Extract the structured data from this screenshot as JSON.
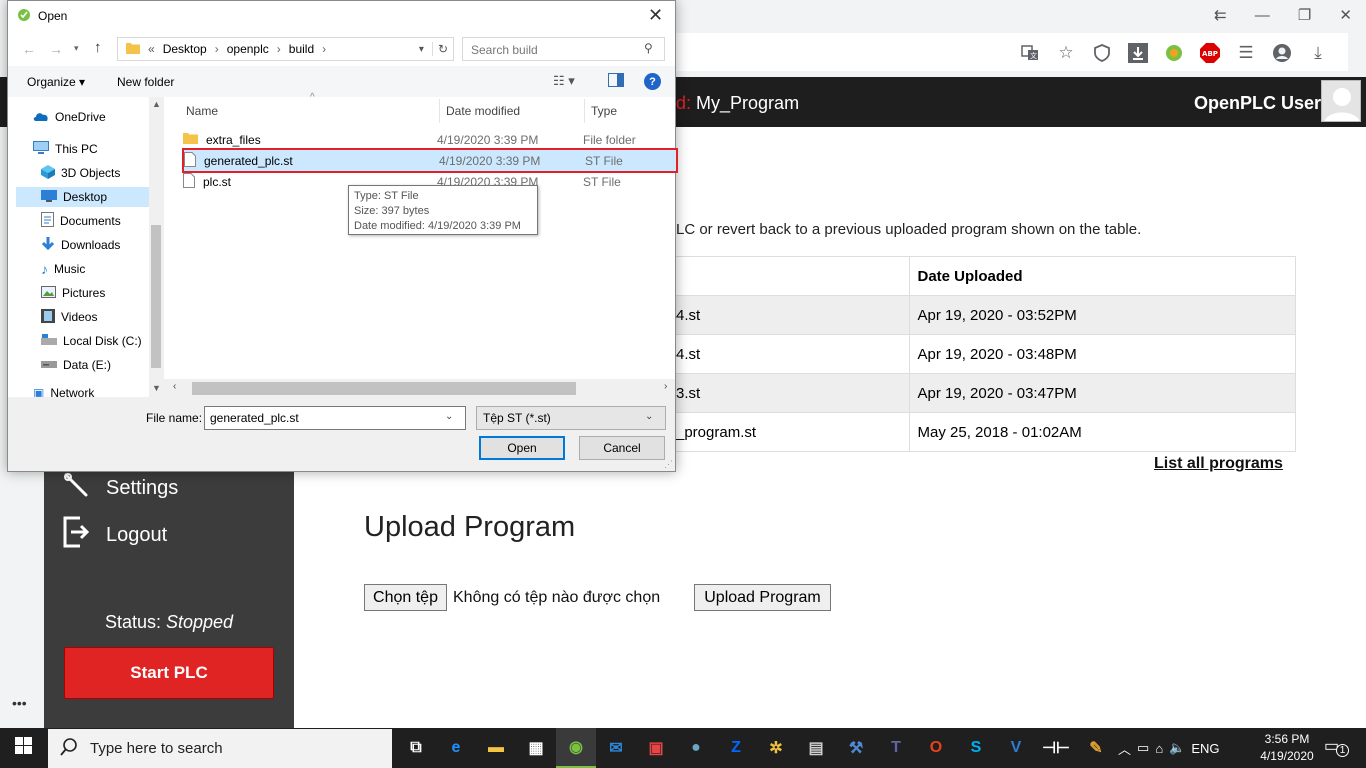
{
  "browser": {
    "window_controls": [
      "⇇",
      "—",
      "❐",
      "✕"
    ],
    "toolbar_icons": [
      "translate-icon",
      "star-icon",
      "shield-icon",
      "download-box-icon",
      "chrome-ext-icon",
      "abp-icon",
      "playlist-icon",
      "account-icon",
      "download-icon"
    ],
    "abp_label": "ABP"
  },
  "plc": {
    "program_prefix": "d:",
    "program_name": "My_Program",
    "user_name": "OpenPLC User",
    "sidebar": {
      "settings_label": "Settings",
      "logout_label": "Logout",
      "status_label": "Status:",
      "status_value": "Stopped",
      "start_button": "Start PLC"
    },
    "intro_text": "LC or revert back to a previous uploaded program shown on the table.",
    "table": {
      "header_date": "Date Uploaded",
      "rows": [
        {
          "file": "4.st",
          "date": "Apr 19, 2020 - 03:52PM"
        },
        {
          "file": "4.st",
          "date": "Apr 19, 2020 - 03:48PM"
        },
        {
          "file": "3.st",
          "date": "Apr 19, 2020 - 03:47PM"
        },
        {
          "file": "_program.st",
          "date": "May 25, 2018 - 01:02AM"
        }
      ]
    },
    "list_all_link": "List all programs",
    "upload_title": "Upload Program",
    "choose_file_button": "Chọn tệp",
    "no_file_text": "Không có tệp nào được chọn",
    "upload_button": "Upload Program",
    "more_dots": "•••"
  },
  "dialog": {
    "title": "Open",
    "path": {
      "prefix": "«",
      "segments": [
        "Desktop",
        "openplc",
        "build"
      ]
    },
    "search_placeholder": "Search build",
    "organize_label": "Organize ▾",
    "new_folder_label": "New folder",
    "help_label": "?",
    "nav_items": [
      {
        "label": "OneDrive",
        "icon": "onedrive-icon"
      },
      {
        "label": "This PC",
        "icon": "pc-icon"
      },
      {
        "label": "3D Objects",
        "icon": "cube-icon"
      },
      {
        "label": "Desktop",
        "icon": "desktop-icon"
      },
      {
        "label": "Documents",
        "icon": "documents-icon"
      },
      {
        "label": "Downloads",
        "icon": "download-icon"
      },
      {
        "label": "Music",
        "icon": "music-icon"
      },
      {
        "label": "Pictures",
        "icon": "pictures-icon"
      },
      {
        "label": "Videos",
        "icon": "videos-icon"
      },
      {
        "label": "Local Disk (C:)",
        "icon": "disk-icon"
      },
      {
        "label": "Data (E:)",
        "icon": "disk-icon"
      },
      {
        "label": "Network",
        "icon": "network-icon"
      }
    ],
    "columns": {
      "name": "Name",
      "date": "Date modified",
      "type": "Type"
    },
    "files": [
      {
        "name": "extra_files",
        "date": "4/19/2020 3:39 PM",
        "type": "File folder",
        "icon": "folder-icon"
      },
      {
        "name": "generated_plc.st",
        "date": "4/19/2020 3:39 PM",
        "type": "ST File",
        "icon": "file-icon"
      },
      {
        "name": "plc.st",
        "date": "4/19/2020 3:39 PM",
        "type": "ST File",
        "icon": "file-icon"
      }
    ],
    "tooltip": {
      "line1": "Type: ST File",
      "line2": "Size: 397 bytes",
      "line3": "Date modified: 4/19/2020 3:39 PM"
    },
    "file_name_label": "File name:",
    "file_name_value": "generated_plc.st",
    "filter_value": "Tệp ST (*.st)",
    "open_button": "Open",
    "cancel_button": "Cancel"
  },
  "taskbar": {
    "search_placeholder": "Type here to search",
    "language": "ENG",
    "time": "3:56 PM",
    "date": "4/19/2020",
    "notification_count": "1",
    "apps": [
      {
        "name": "task-view-icon",
        "glyph": "⧉",
        "color": "#ffffff"
      },
      {
        "name": "edge-icon",
        "glyph": "e",
        "color": "#1e90ff"
      },
      {
        "name": "file-explorer-icon",
        "glyph": "▬",
        "color": "#f4c542"
      },
      {
        "name": "store-icon",
        "glyph": "▦",
        "color": "#ffffff"
      },
      {
        "name": "coccoc-icon",
        "glyph": "◉",
        "color": "#7ac143"
      },
      {
        "name": "mail-icon",
        "glyph": "✉",
        "color": "#2b88d8"
      },
      {
        "name": "app-icon-red",
        "glyph": "▣",
        "color": "#e64545"
      },
      {
        "name": "globe-icon",
        "glyph": "●",
        "color": "#6aa7c4"
      },
      {
        "name": "zalo-icon",
        "glyph": "Z",
        "color": "#0068ff"
      },
      {
        "name": "tool-icon",
        "glyph": "✲",
        "color": "#f0c040"
      },
      {
        "name": "usb-icon",
        "glyph": "▤",
        "color": "#cfcfcf"
      },
      {
        "name": "network-app-icon",
        "glyph": "⚒",
        "color": "#4f8ad8"
      },
      {
        "name": "teams-icon",
        "glyph": "T",
        "color": "#6264a7"
      },
      {
        "name": "office-icon",
        "glyph": "O",
        "color": "#e8411b"
      },
      {
        "name": "skype-icon",
        "glyph": "S",
        "color": "#00aff0"
      },
      {
        "name": "vs-icon",
        "glyph": "V",
        "color": "#2d7dd2"
      },
      {
        "name": "ladder-icon",
        "glyph": "⊣⊢",
        "color": "#ffffff"
      },
      {
        "name": "paint-icon",
        "glyph": "✎",
        "color": "#e0a030"
      }
    ]
  }
}
